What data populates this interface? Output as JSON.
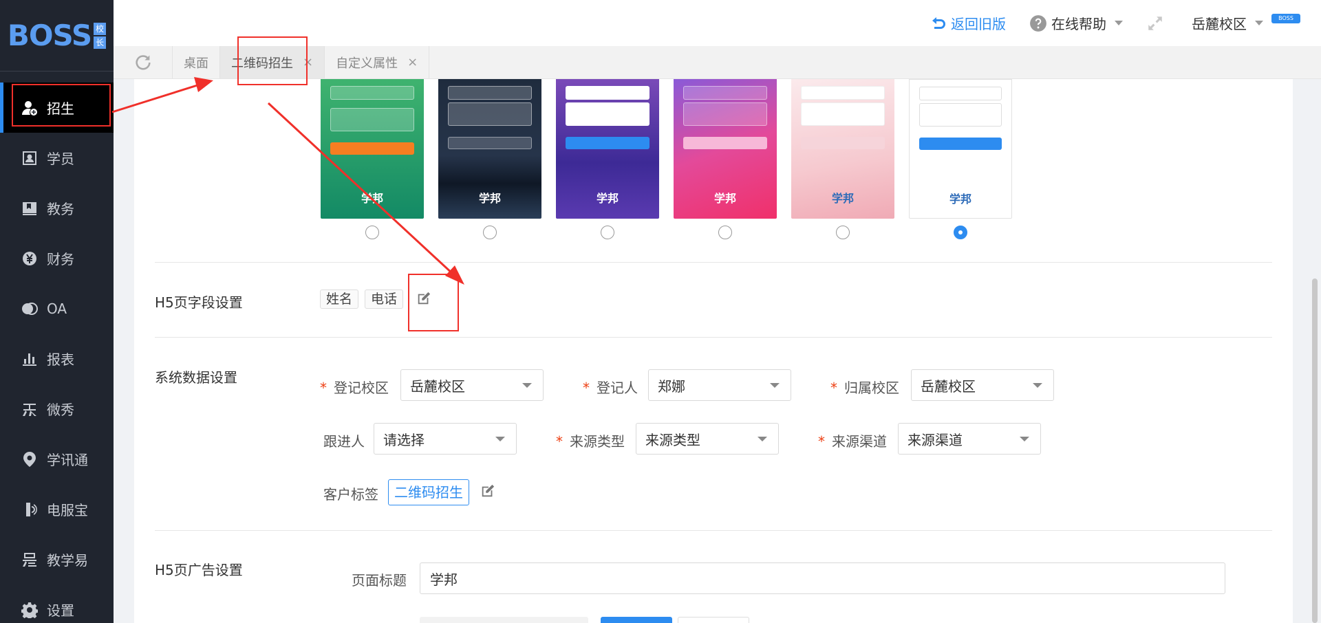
{
  "logo": {
    "text": "BOSS",
    "badge": [
      "校",
      "长"
    ]
  },
  "sidebar": {
    "items": [
      {
        "label": "招生",
        "icon": "user-add-icon",
        "active": true
      },
      {
        "label": "学员",
        "icon": "student-card-icon"
      },
      {
        "label": "教务",
        "icon": "book-icon"
      },
      {
        "label": "财务",
        "icon": "yen-coin-icon"
      },
      {
        "label": "OA",
        "icon": "oa-toggle-icon"
      },
      {
        "label": "报表",
        "icon": "bar-chart-icon"
      },
      {
        "label": "微秀",
        "icon": "weixiu-icon"
      },
      {
        "label": "学讯通",
        "icon": "location-pin-icon"
      },
      {
        "label": "电服宝",
        "icon": "phone-service-icon"
      },
      {
        "label": "教学易",
        "icon": "teach-easy-icon"
      },
      {
        "label": "设置",
        "icon": "gear-icon"
      }
    ]
  },
  "topbar": {
    "back_old": "返回旧版",
    "help": "在线帮助",
    "campus": "岳麓校区",
    "mini_logo": "BOSS"
  },
  "tabs": [
    {
      "label": "桌面",
      "closable": false
    },
    {
      "label": "二维码招生",
      "closable": true,
      "active": true
    },
    {
      "label": "自定义属性",
      "closable": true
    }
  ],
  "themes": {
    "selected_index": 5,
    "items": [
      {
        "bg": "#1a9b6a",
        "btn": "#f57e21"
      },
      {
        "bg": "#1d2736",
        "btn": "#3a4558"
      },
      {
        "bg": "#4a2a8c",
        "btn": "#2d8cf0"
      },
      {
        "bg": "#e0408a",
        "btn": "#f7b8d8"
      },
      {
        "bg": "#f7d3d8",
        "btn": "#f0a7b5"
      },
      {
        "bg": "#ffffff",
        "btn": "#2d8cf0"
      }
    ],
    "logo_text": "学邦"
  },
  "h5_fields": {
    "label": "H5页字段设置",
    "tags": [
      "姓名",
      "电话"
    ]
  },
  "system": {
    "label": "系统数据设置",
    "reg_campus_label": "登记校区",
    "reg_campus": "岳麓校区",
    "registrant_label": "登记人",
    "registrant": "郑娜",
    "owner_campus_label": "归属校区",
    "owner_campus": "岳麓校区",
    "follower_label": "跟进人",
    "follower": "请选择",
    "source_type_label": "来源类型",
    "source_type": "来源类型",
    "source_channel_label": "来源渠道",
    "source_channel": "来源渠道",
    "customer_tag_label": "客户标签",
    "customer_tag": "二维码招生"
  },
  "ad": {
    "label": "H5页广告设置",
    "page_title_label": "页面标题",
    "page_title": "学邦"
  },
  "colors": {
    "accent": "#2d8cf0",
    "sidebar": "#20252f",
    "annotation": "#f0302a",
    "required": "#ed4014"
  }
}
